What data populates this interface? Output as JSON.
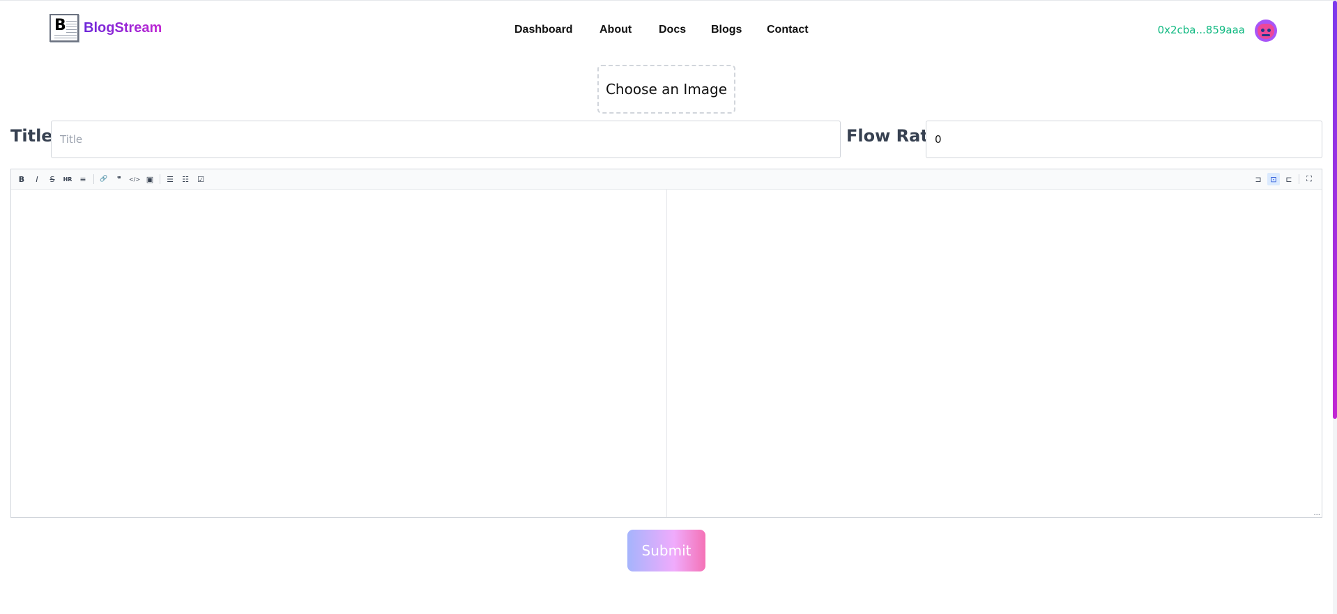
{
  "brand": {
    "logo_letter": "B",
    "name": "BlogStream",
    "gradient": [
      "#6d28d9",
      "#c026d3"
    ]
  },
  "nav": {
    "items": [
      {
        "label": "Dashboard"
      },
      {
        "label": "About"
      },
      {
        "label": "Docs"
      },
      {
        "label": "Blogs"
      },
      {
        "label": "Contact"
      }
    ]
  },
  "wallet": {
    "address": "0x2cba...859aaa",
    "color": "#10b981",
    "avatar_icon": "pixel-avatar-icon"
  },
  "upload": {
    "label": "Choose an Image"
  },
  "form": {
    "title_label": "Title",
    "title_placeholder": "Title",
    "title_value": "",
    "flow_rate_label": "Flow Rate",
    "flow_rate_value": "0"
  },
  "editor": {
    "toolbar_left": [
      {
        "icon": "bold-icon",
        "glyph": "B"
      },
      {
        "icon": "italic-icon",
        "glyph": "I"
      },
      {
        "icon": "strikethrough-icon",
        "glyph": "S"
      },
      {
        "icon": "heading-icon",
        "glyph": "HR"
      },
      {
        "icon": "heading-size-icon",
        "glyph": "≡"
      },
      {
        "icon": "link-icon",
        "glyph": "🔗"
      },
      {
        "icon": "quote-icon",
        "glyph": "❞"
      },
      {
        "icon": "code-icon",
        "glyph": "</>"
      },
      {
        "icon": "image-icon",
        "glyph": "▣"
      },
      {
        "icon": "unordered-list-icon",
        "glyph": "☰"
      },
      {
        "icon": "ordered-list-icon",
        "glyph": "☷"
      },
      {
        "icon": "checklist-icon",
        "glyph": "☑"
      }
    ],
    "toolbar_right": [
      {
        "icon": "edit-mode-icon",
        "glyph": "⊐"
      },
      {
        "icon": "live-mode-icon",
        "glyph": "⊡",
        "active": true
      },
      {
        "icon": "preview-mode-icon",
        "glyph": "⊏"
      },
      {
        "icon": "fullscreen-icon",
        "glyph": "⛶"
      }
    ],
    "content": "",
    "resize_glyph": "..."
  },
  "submit": {
    "label": "Submit"
  }
}
